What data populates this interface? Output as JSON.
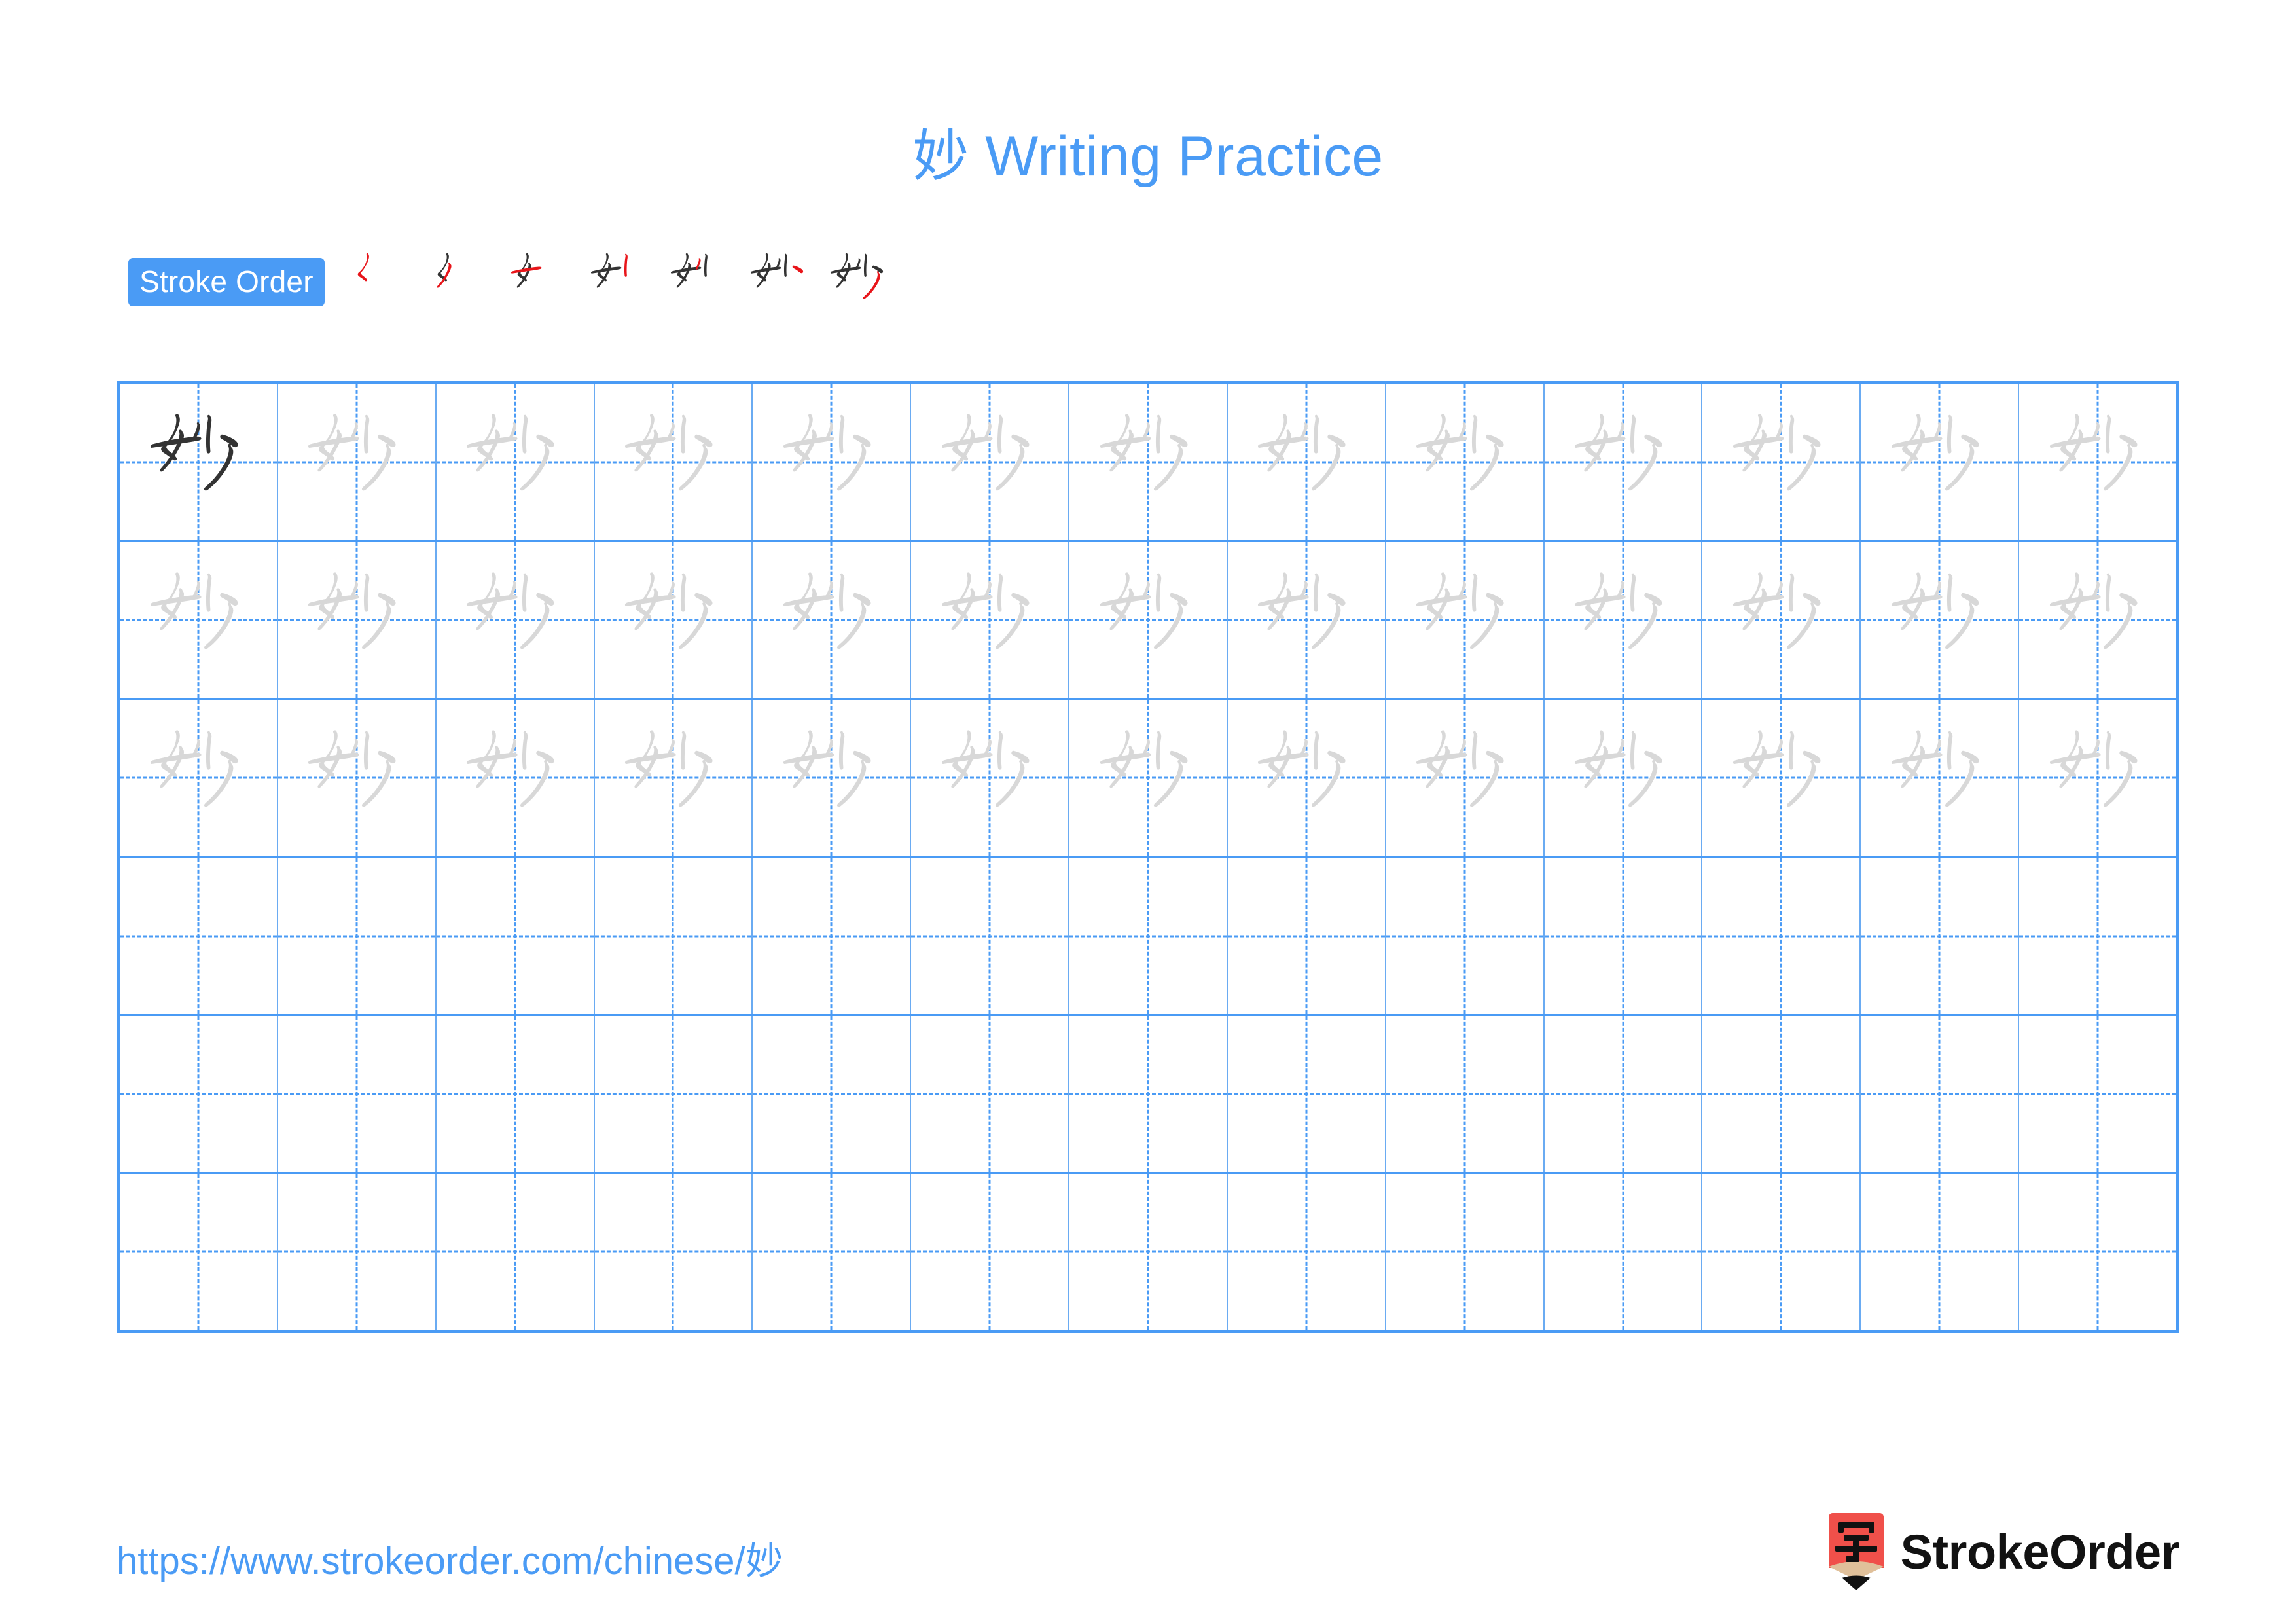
{
  "character": "妙",
  "title": "妙 Writing Practice",
  "colors": {
    "accent_blue": "#4a9bf5",
    "grid_line": "#6aabf2",
    "stroke_new": "#e8151a",
    "stroke_done": "#333333",
    "trace_gray": "#d8d8d8",
    "model_dark": "#333333",
    "logo_red": "#f0504a",
    "logo_wood": "#e0c09a",
    "logo_tip": "#111111"
  },
  "stroke_order": {
    "badge_label": "Stroke Order",
    "total_strokes": 7,
    "steps": [
      {
        "index": 1,
        "new_stroke": "stroke-1",
        "strokes_shown": 1
      },
      {
        "index": 2,
        "new_stroke": "stroke-2",
        "strokes_shown": 2
      },
      {
        "index": 3,
        "new_stroke": "stroke-3",
        "strokes_shown": 3
      },
      {
        "index": 4,
        "new_stroke": "stroke-4",
        "strokes_shown": 4
      },
      {
        "index": 5,
        "new_stroke": "stroke-5",
        "strokes_shown": 5
      },
      {
        "index": 6,
        "new_stroke": "stroke-6",
        "strokes_shown": 6
      },
      {
        "index": 7,
        "new_stroke": "stroke-7",
        "strokes_shown": 7
      }
    ]
  },
  "practice_grid": {
    "columns": 13,
    "rows": 6,
    "guide_style": "dashed-crosshair",
    "cells": [
      [
        "model",
        "trace",
        "trace",
        "trace",
        "trace",
        "trace",
        "trace",
        "trace",
        "trace",
        "trace",
        "trace",
        "trace",
        "trace"
      ],
      [
        "trace",
        "trace",
        "trace",
        "trace",
        "trace",
        "trace",
        "trace",
        "trace",
        "trace",
        "trace",
        "trace",
        "trace",
        "trace"
      ],
      [
        "trace",
        "trace",
        "trace",
        "trace",
        "trace",
        "trace",
        "trace",
        "trace",
        "trace",
        "trace",
        "trace",
        "trace",
        "trace"
      ],
      [
        "empty",
        "empty",
        "empty",
        "empty",
        "empty",
        "empty",
        "empty",
        "empty",
        "empty",
        "empty",
        "empty",
        "empty",
        "empty"
      ],
      [
        "empty",
        "empty",
        "empty",
        "empty",
        "empty",
        "empty",
        "empty",
        "empty",
        "empty",
        "empty",
        "empty",
        "empty",
        "empty"
      ],
      [
        "empty",
        "empty",
        "empty",
        "empty",
        "empty",
        "empty",
        "empty",
        "empty",
        "empty",
        "empty",
        "empty",
        "empty",
        "empty"
      ]
    ]
  },
  "footer": {
    "url": "https://www.strokeorder.com/chinese/妙",
    "brand_name": "StrokeOrder",
    "logo_glyph": "字"
  }
}
